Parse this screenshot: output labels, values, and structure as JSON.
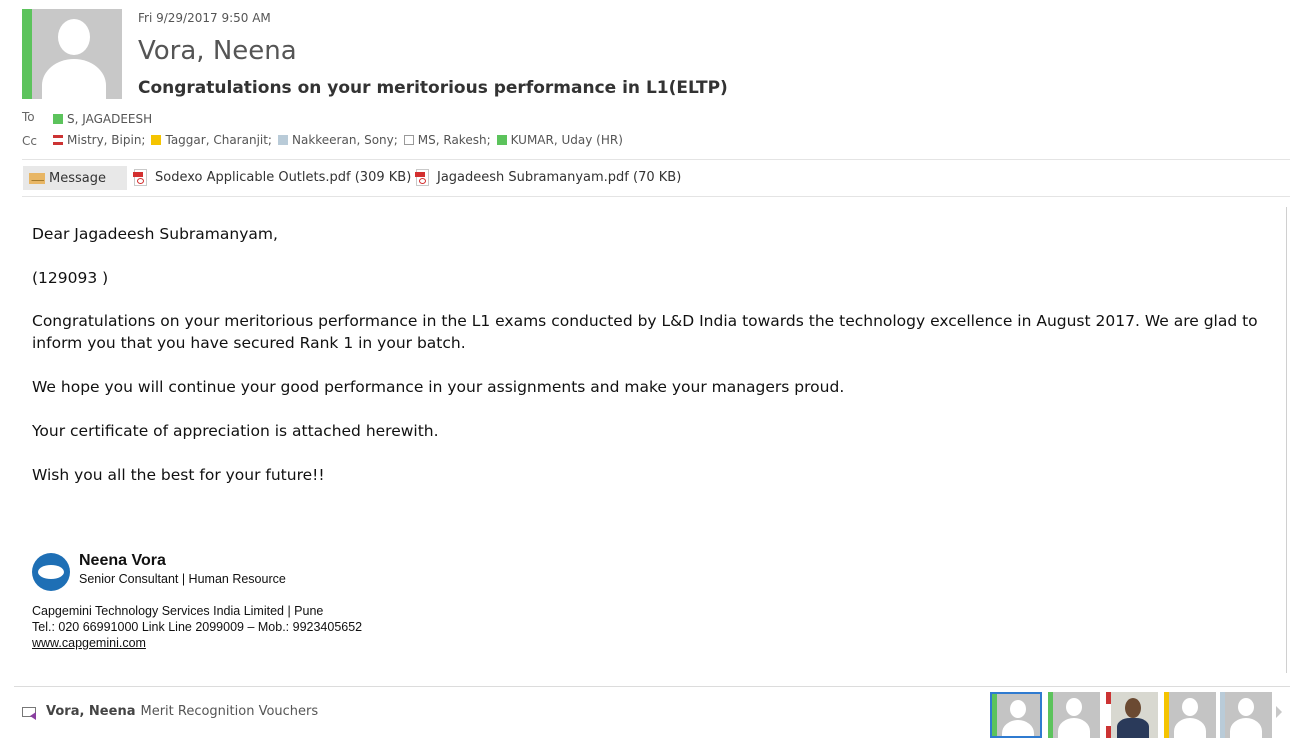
{
  "header": {
    "date": "Fri 9/29/2017 9:50 AM",
    "sender": "Vora, Neena",
    "subject": "Congratulations on your meritorious performance in L1(ELTP)",
    "sender_status_color": "#5cc35c"
  },
  "to": {
    "label": "To",
    "recipients": [
      {
        "name": "S, JAGADEESH",
        "color": "#5cc35c"
      }
    ]
  },
  "cc": {
    "label": "Cc",
    "recipients": [
      {
        "name": "Mistry, Bipin;",
        "color": "#cc3333",
        "icon": "busy-status-icon"
      },
      {
        "name": "Taggar, Charanjit;",
        "color": "#f5c400",
        "icon": "away-status-icon"
      },
      {
        "name": "Nakkeeran, Sony;",
        "color": "#b9cbd8",
        "icon": "unknown-status-icon"
      },
      {
        "name": "MS, Rakesh;",
        "color": "#ffffff",
        "icon": "offline-status-icon"
      },
      {
        "name": "KUMAR, Uday (HR)",
        "color": "#5cc35c",
        "icon": "available-status-icon"
      }
    ]
  },
  "attachments": {
    "message_tab": "Message",
    "files": [
      {
        "name": "Sodexo Applicable Outlets.pdf (309 KB)"
      },
      {
        "name": "Jagadeesh Subramanyam.pdf (70 KB)"
      }
    ]
  },
  "body": {
    "greeting": "Dear  Jagadeesh Subramanyam,",
    "id_line": "(129093 )",
    "p1_line1": "Congratulations on your meritorious performance in the L1 exams conducted by L&D India  towards the technology excellence in August 2017.  We are glad to",
    "p1_line2": "inform you that you have secured Rank  1  in your batch.",
    "p2": "We hope you will continue your good performance in your assignments and make your managers proud.",
    "p3": "Your certificate of appreciation is attached herewith.",
    "p4": "Wish you all the best for your future!!"
  },
  "signature": {
    "name": "Neena Vora",
    "title": "Senior Consultant | Human Resource",
    "company": "Capgemini Technology Services India Limited | Pune",
    "phone": "Tel.: 020 66991000 Link Line 2099009 – Mob.: 9923405652",
    "website": "www.capgemini.com"
  },
  "people_pane": {
    "sender": "Vora, Neena",
    "item": "Merit Recognition Vouchers",
    "thumbnails": [
      {
        "color": "#5cc35c",
        "selected": true
      },
      {
        "color": "#5cc35c",
        "selected": false
      },
      {
        "color": "#cc3333",
        "selected": false,
        "photo": true
      },
      {
        "color": "#f5c400",
        "selected": false
      },
      {
        "color": "#b9cbd8",
        "selected": false
      }
    ]
  }
}
